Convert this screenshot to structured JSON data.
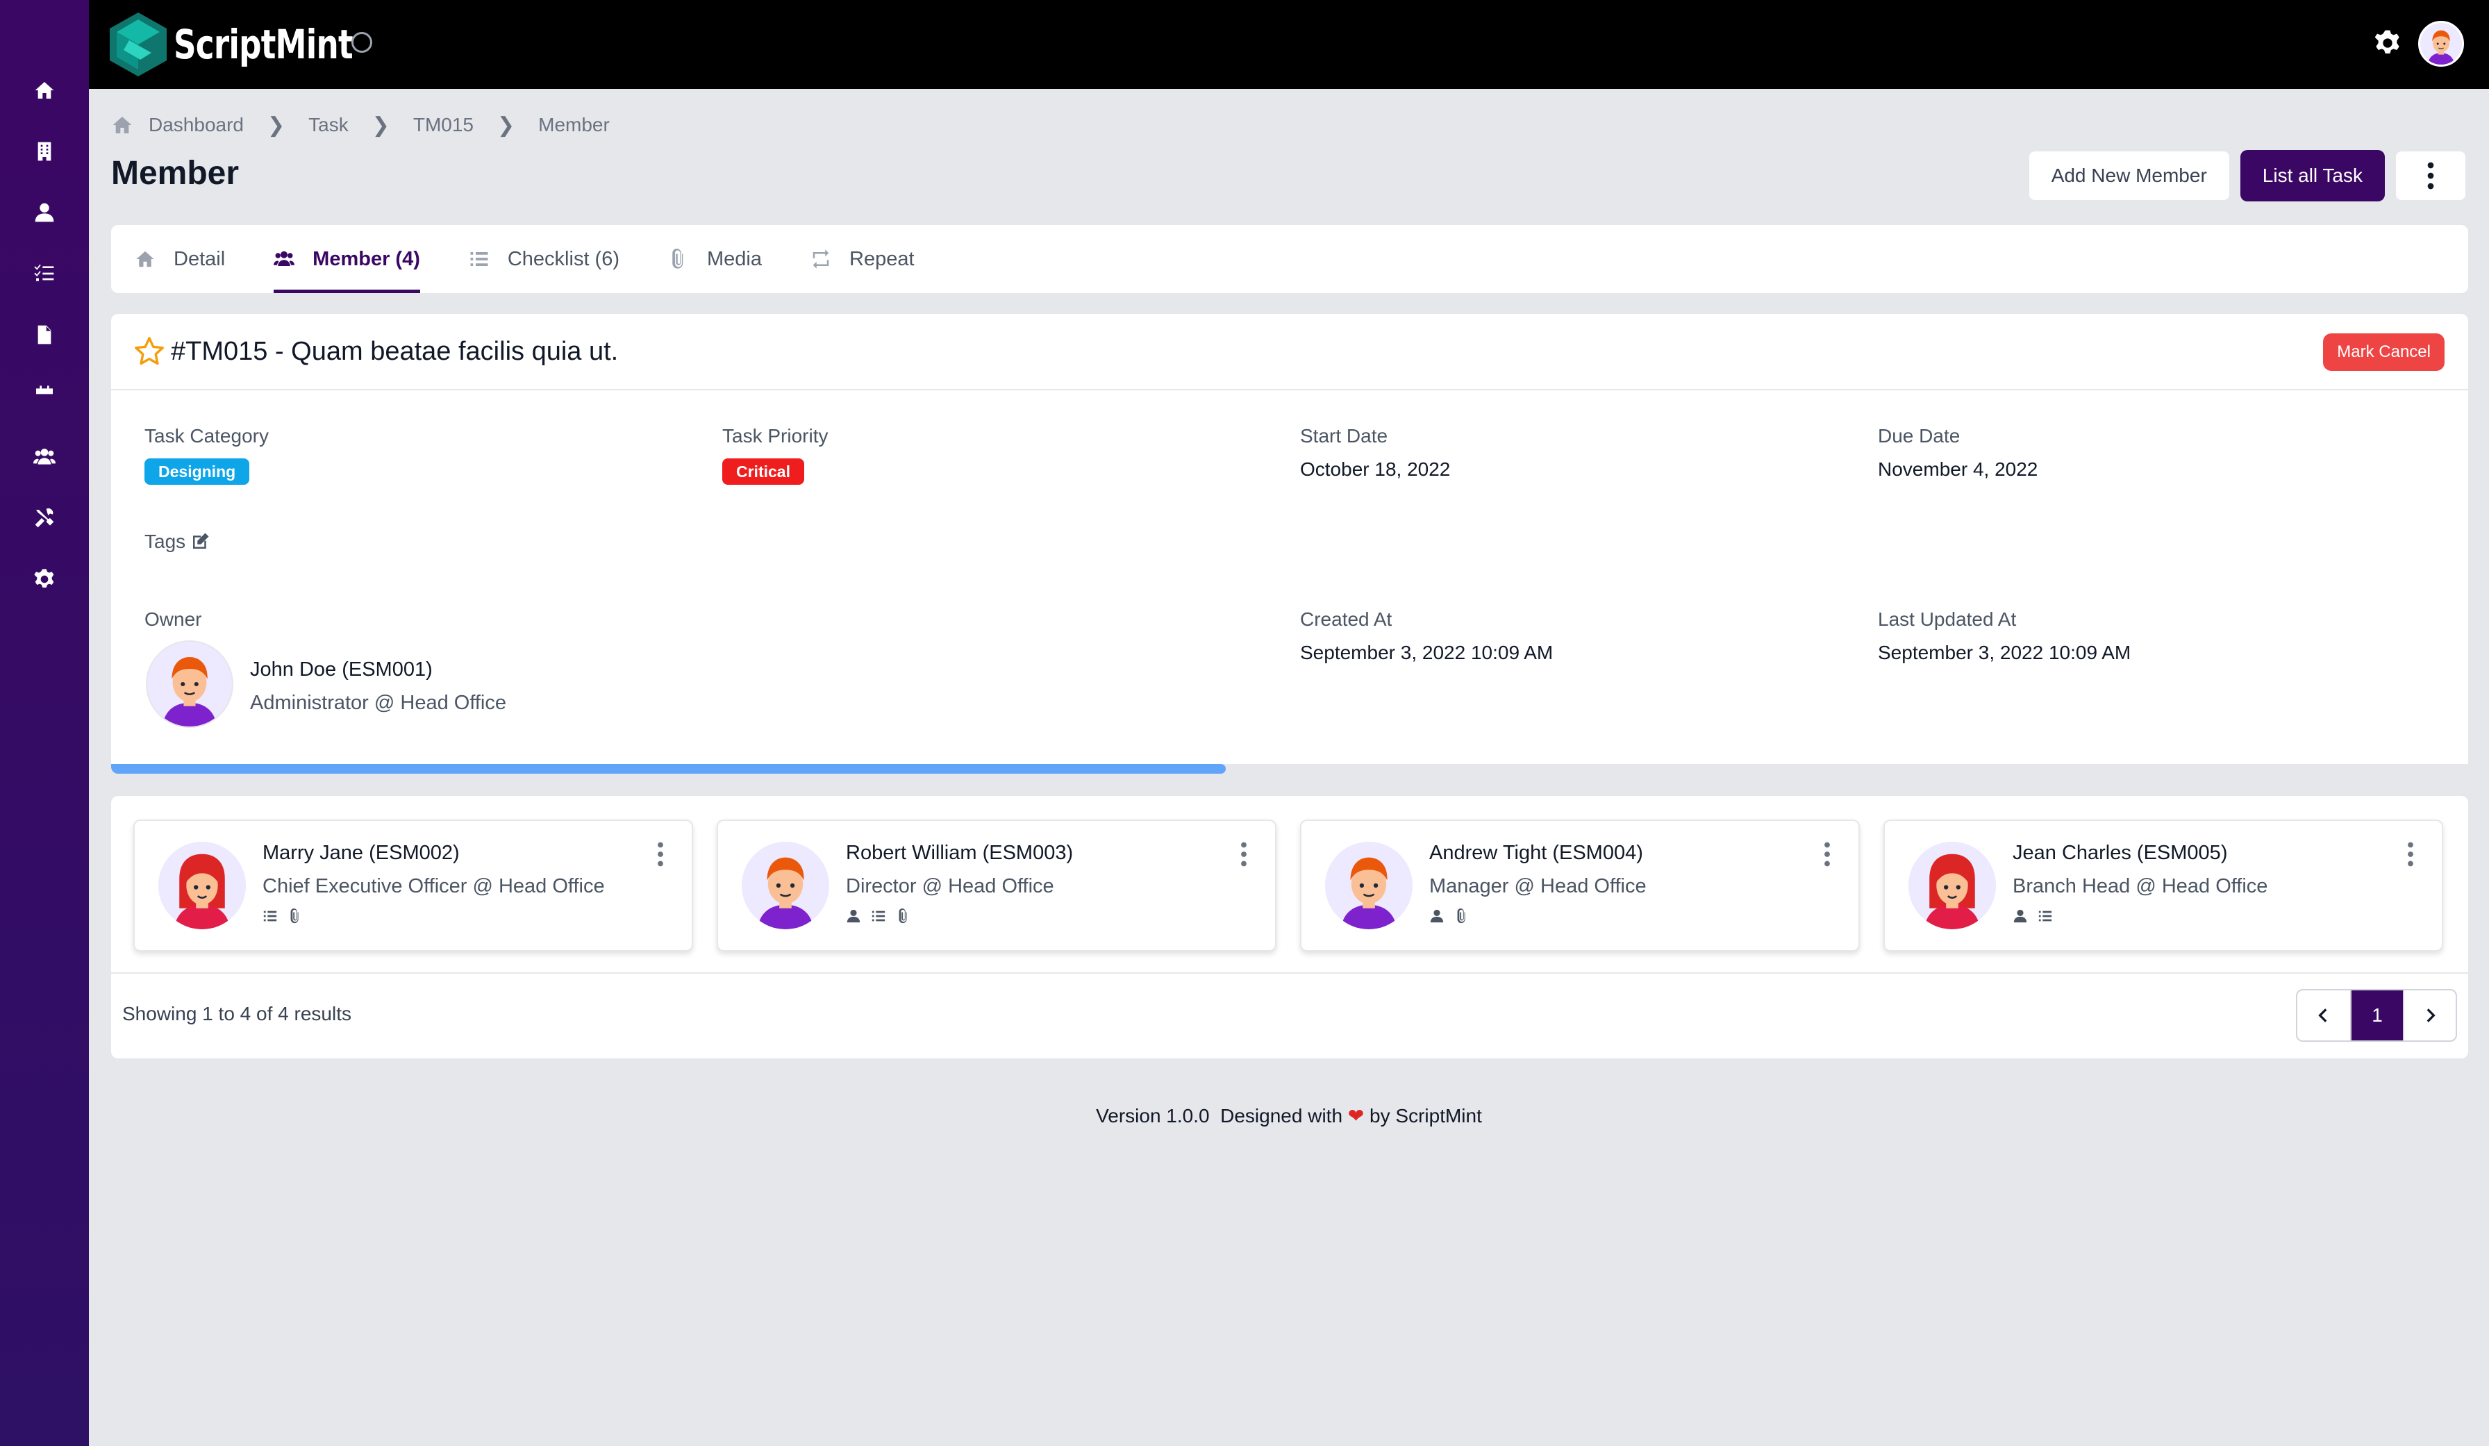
{
  "app": {
    "logo_text": "ScriptMint"
  },
  "sidebar": {
    "items": [
      {
        "icon": "home-icon"
      },
      {
        "icon": "building-icon"
      },
      {
        "icon": "user-icon"
      },
      {
        "icon": "task-list-icon"
      },
      {
        "icon": "document-icon"
      },
      {
        "icon": "calendar-icon"
      },
      {
        "icon": "users-icon"
      },
      {
        "icon": "tools-icon"
      },
      {
        "icon": "gear-icon"
      }
    ]
  },
  "breadcrumb": {
    "items": [
      "Dashboard",
      "Task",
      "TM015",
      "Member"
    ]
  },
  "page": {
    "title": "Member"
  },
  "actions": {
    "add_member": "Add New Member",
    "list_all": "List all Task"
  },
  "tabs": [
    {
      "label": "Detail",
      "icon": "home-icon"
    },
    {
      "label": "Member (4)",
      "icon": "users-icon",
      "active": true
    },
    {
      "label": "Checklist (6)",
      "icon": "list-icon"
    },
    {
      "label": "Media",
      "icon": "paperclip-icon"
    },
    {
      "label": "Repeat",
      "icon": "repeat-icon"
    }
  ],
  "task": {
    "title": "#TM015 - Quam beatae facilis quia ut.",
    "mark_cancel": "Mark Cancel",
    "category_label": "Task Category",
    "category_value": "Designing",
    "priority_label": "Task Priority",
    "priority_value": "Critical",
    "start_label": "Start Date",
    "start_value": "October 18, 2022",
    "due_label": "Due Date",
    "due_value": "November 4, 2022",
    "tags_label": "Tags",
    "owner_label": "Owner",
    "owner_name": "John Doe (ESM001)",
    "owner_role": "Administrator @ Head Office",
    "created_label": "Created At",
    "created_value": "September 3, 2022 10:09 AM",
    "updated_label": "Last Updated At",
    "updated_value": "September 3, 2022 10:09 AM",
    "progress": 0.5
  },
  "members": [
    {
      "name": "Marry Jane (ESM002)",
      "role": "Chief Executive Officer @ Head Office",
      "gender": "female",
      "icons": [
        "list-icon",
        "paperclip-icon"
      ]
    },
    {
      "name": "Robert William (ESM003)",
      "role": "Director @ Head Office",
      "gender": "male",
      "icons": [
        "user-icon",
        "list-icon",
        "paperclip-icon"
      ]
    },
    {
      "name": "Andrew Tight (ESM004)",
      "role": "Manager @ Head Office",
      "gender": "male",
      "icons": [
        "user-icon",
        "paperclip-icon"
      ]
    },
    {
      "name": "Jean Charles (ESM005)",
      "role": "Branch Head @ Head Office",
      "gender": "female",
      "icons": [
        "user-icon",
        "list-icon"
      ]
    }
  ],
  "pagination": {
    "summary": "Showing 1 to 4 of 4 results",
    "current": "1"
  },
  "footer": {
    "version": "Version 1.0.0",
    "designed": "Designed with",
    "by": "by ScriptMint"
  },
  "colors": {
    "sidebar": "#3b0764",
    "primary": "#3b0764",
    "category_badge": "#0ea5e9",
    "priority_badge": "#ef1d1d",
    "cancel": "#ef4444",
    "progress": "#60a5fa"
  }
}
